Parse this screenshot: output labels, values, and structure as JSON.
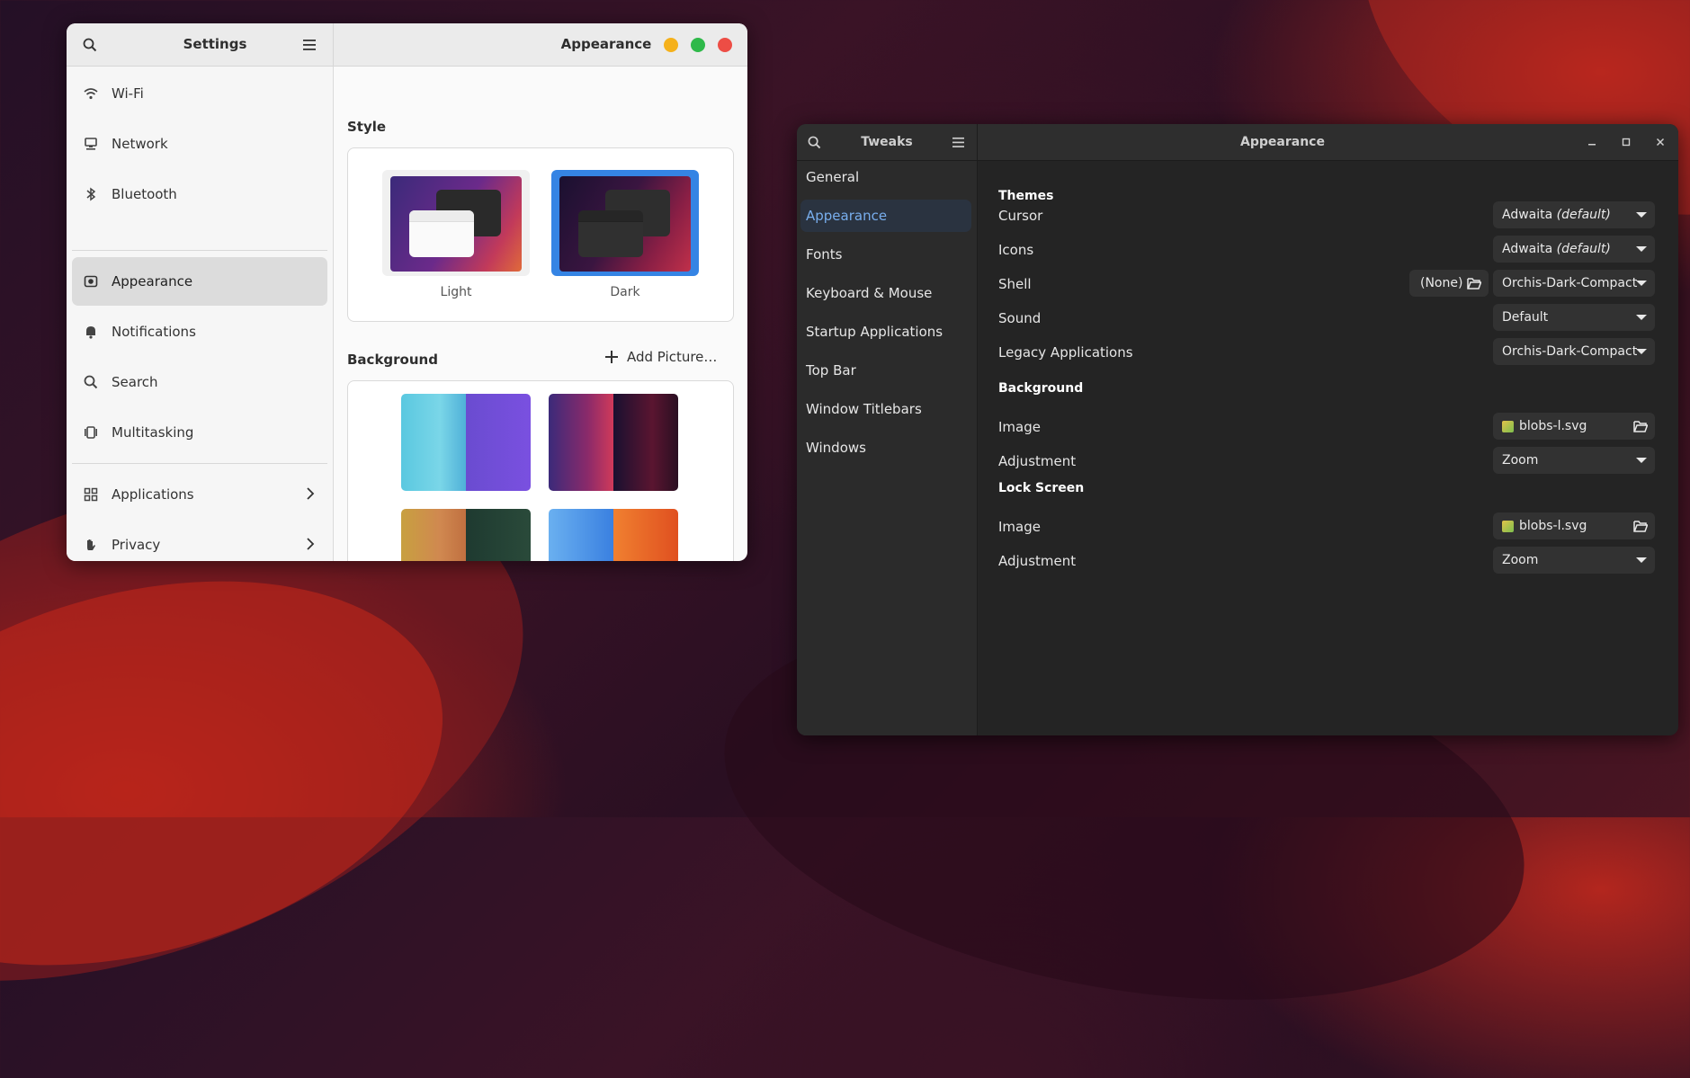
{
  "settings": {
    "title": "Settings",
    "page_title": "Appearance",
    "sidebar": [
      {
        "label": "Wi-Fi",
        "icon": "wifi-icon"
      },
      {
        "label": "Network",
        "icon": "network-icon"
      },
      {
        "label": "Bluetooth",
        "icon": "bluetooth-icon"
      },
      {
        "label": "Appearance",
        "icon": "appearance-icon",
        "active": true
      },
      {
        "label": "Notifications",
        "icon": "bell-icon"
      },
      {
        "label": "Search",
        "icon": "search-icon"
      },
      {
        "label": "Multitasking",
        "icon": "multitasking-icon"
      },
      {
        "label": "Applications",
        "icon": "apps-grid-icon",
        "has_submenu": true
      },
      {
        "label": "Privacy",
        "icon": "hand-icon",
        "has_submenu": true
      }
    ],
    "style_section": "Style",
    "style_options": [
      {
        "label": "Light",
        "selected": false
      },
      {
        "label": "Dark",
        "selected": true
      }
    ],
    "background_section": "Background",
    "add_picture": "Add Picture…"
  },
  "tweaks": {
    "title": "Tweaks",
    "page_title": "Appearance",
    "sidebar": [
      {
        "label": "General"
      },
      {
        "label": "Appearance",
        "active": true
      },
      {
        "label": "Fonts"
      },
      {
        "label": "Keyboard & Mouse"
      },
      {
        "label": "Startup Applications"
      },
      {
        "label": "Top Bar"
      },
      {
        "label": "Window Titlebars"
      },
      {
        "label": "Windows"
      }
    ],
    "themes": {
      "heading": "Themes",
      "cursor_label": "Cursor",
      "cursor_value": "Adwaita",
      "cursor_suffix": "(default)",
      "icons_label": "Icons",
      "icons_value": "Adwaita",
      "icons_suffix": "(default)",
      "shell_label": "Shell",
      "shell_file": "(None)",
      "shell_value": "Orchis-Dark-Compact",
      "sound_label": "Sound",
      "sound_value": "Default",
      "legacy_label": "Legacy Applications",
      "legacy_value": "Orchis-Dark-Compact"
    },
    "background": {
      "heading": "Background",
      "image_label": "Image",
      "image_value": "blobs-l.svg",
      "adjustment_label": "Adjustment",
      "adjustment_value": "Zoom"
    },
    "lock_screen": {
      "heading": "Lock Screen",
      "image_label": "Image",
      "image_value": "blobs-l.svg",
      "adjustment_label": "Adjustment",
      "adjustment_value": "Zoom"
    }
  },
  "colors": {
    "accent": "#3584e4",
    "tweaks_active_text": "#78aeed",
    "close": "#ed4d45",
    "minimize": "#f5b11b",
    "maximize": "#2fb94a"
  }
}
